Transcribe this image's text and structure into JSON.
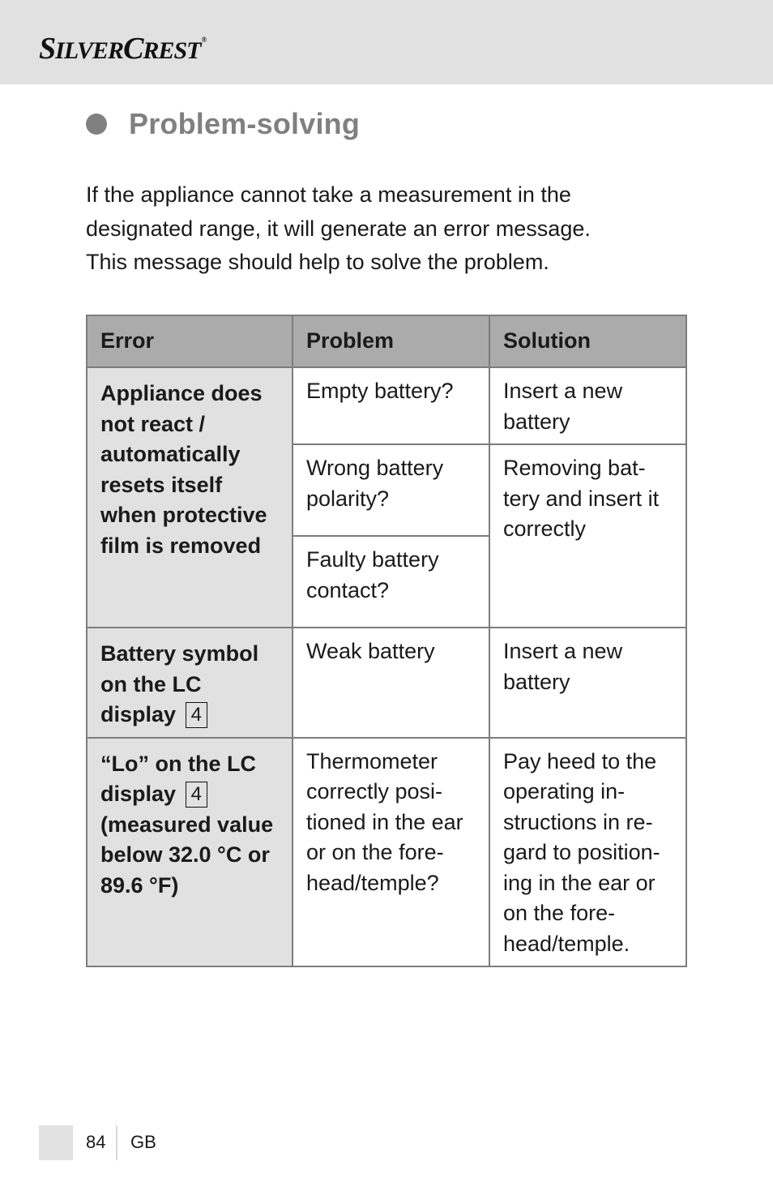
{
  "header": {
    "brand_first_cap": "S",
    "brand_rest1": "ILVER",
    "brand_second_cap": "C",
    "brand_rest2": "REST",
    "brand_mark": "®"
  },
  "section": {
    "bullet_icon": "filled-circle-bullet",
    "title": "Problem-solving"
  },
  "intro": {
    "lines": [
      "If the appliance cannot take a measurement in the",
      "designated range, it will generate an error message.",
      "This message should help to solve the problem."
    ]
  },
  "table": {
    "headers": [
      "Error",
      "Problem",
      "Solution"
    ],
    "rows": [
      {
        "error": "Appliance does not re­act / automat­ically resets itself when protective film is removed",
        "problems": [
          "Empty battery?",
          "Wrong battery polarity?",
          "Faulty battery contact?"
        ],
        "solutions": [
          "Insert a new battery",
          "Removing bat­tery and insert it correctly"
        ]
      },
      {
        "error": "Battery sym­bol on the LC display",
        "error_ref": "4",
        "problem": "Weak battery",
        "solution": "Insert a new battery"
      },
      {
        "error_part1": "“Lo” on the LC display",
        "error_ref": "4",
        "error_part2": "(measured value below 32.0 °C or 89.6 °F)",
        "problem": "Thermometer correctly posi­tioned in the ear or on the fore­head/temple?",
        "solution": "Pay heed to the operating in­structions in re­gard to position­ing in the ear or on the fore­head/temple."
      }
    ]
  },
  "footer": {
    "page_number": "84",
    "language": "GB"
  }
}
